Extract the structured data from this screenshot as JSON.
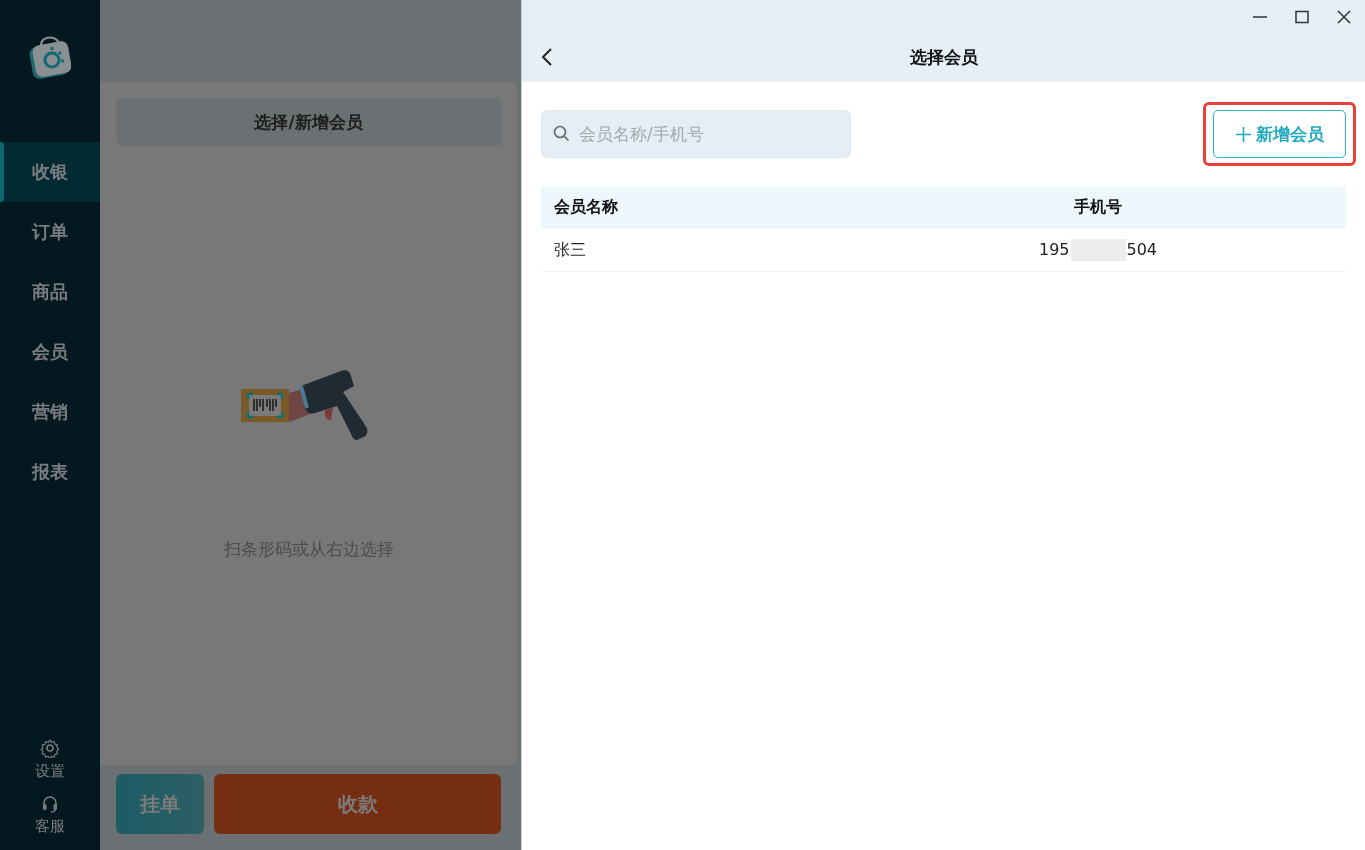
{
  "sidebar": {
    "items": [
      {
        "label": "收银",
        "selected": true
      },
      {
        "label": "订单",
        "selected": false
      },
      {
        "label": "商品",
        "selected": false
      },
      {
        "label": "会员",
        "selected": false
      },
      {
        "label": "营销",
        "selected": false
      },
      {
        "label": "报表",
        "selected": false
      }
    ],
    "bottom_items": [
      {
        "kind": "settings",
        "label": "设置"
      },
      {
        "kind": "support",
        "label": "客服"
      }
    ]
  },
  "cart": {
    "member_button": "选择/新增会员",
    "empty_hint": "扫条形码或从右边选择",
    "hold_button": "挂单",
    "pay_button": "收款"
  },
  "member_panel": {
    "title": "选择会员",
    "search": {
      "placeholder": "会员名称/手机号"
    },
    "add_button": {
      "label": "新增会员",
      "highlighted": true
    },
    "table": {
      "columns": [
        "会员名称",
        "手机号"
      ],
      "rows": [
        {
          "name": "张三",
          "phone_start": "195",
          "phone_end": "504"
        }
      ]
    }
  }
}
